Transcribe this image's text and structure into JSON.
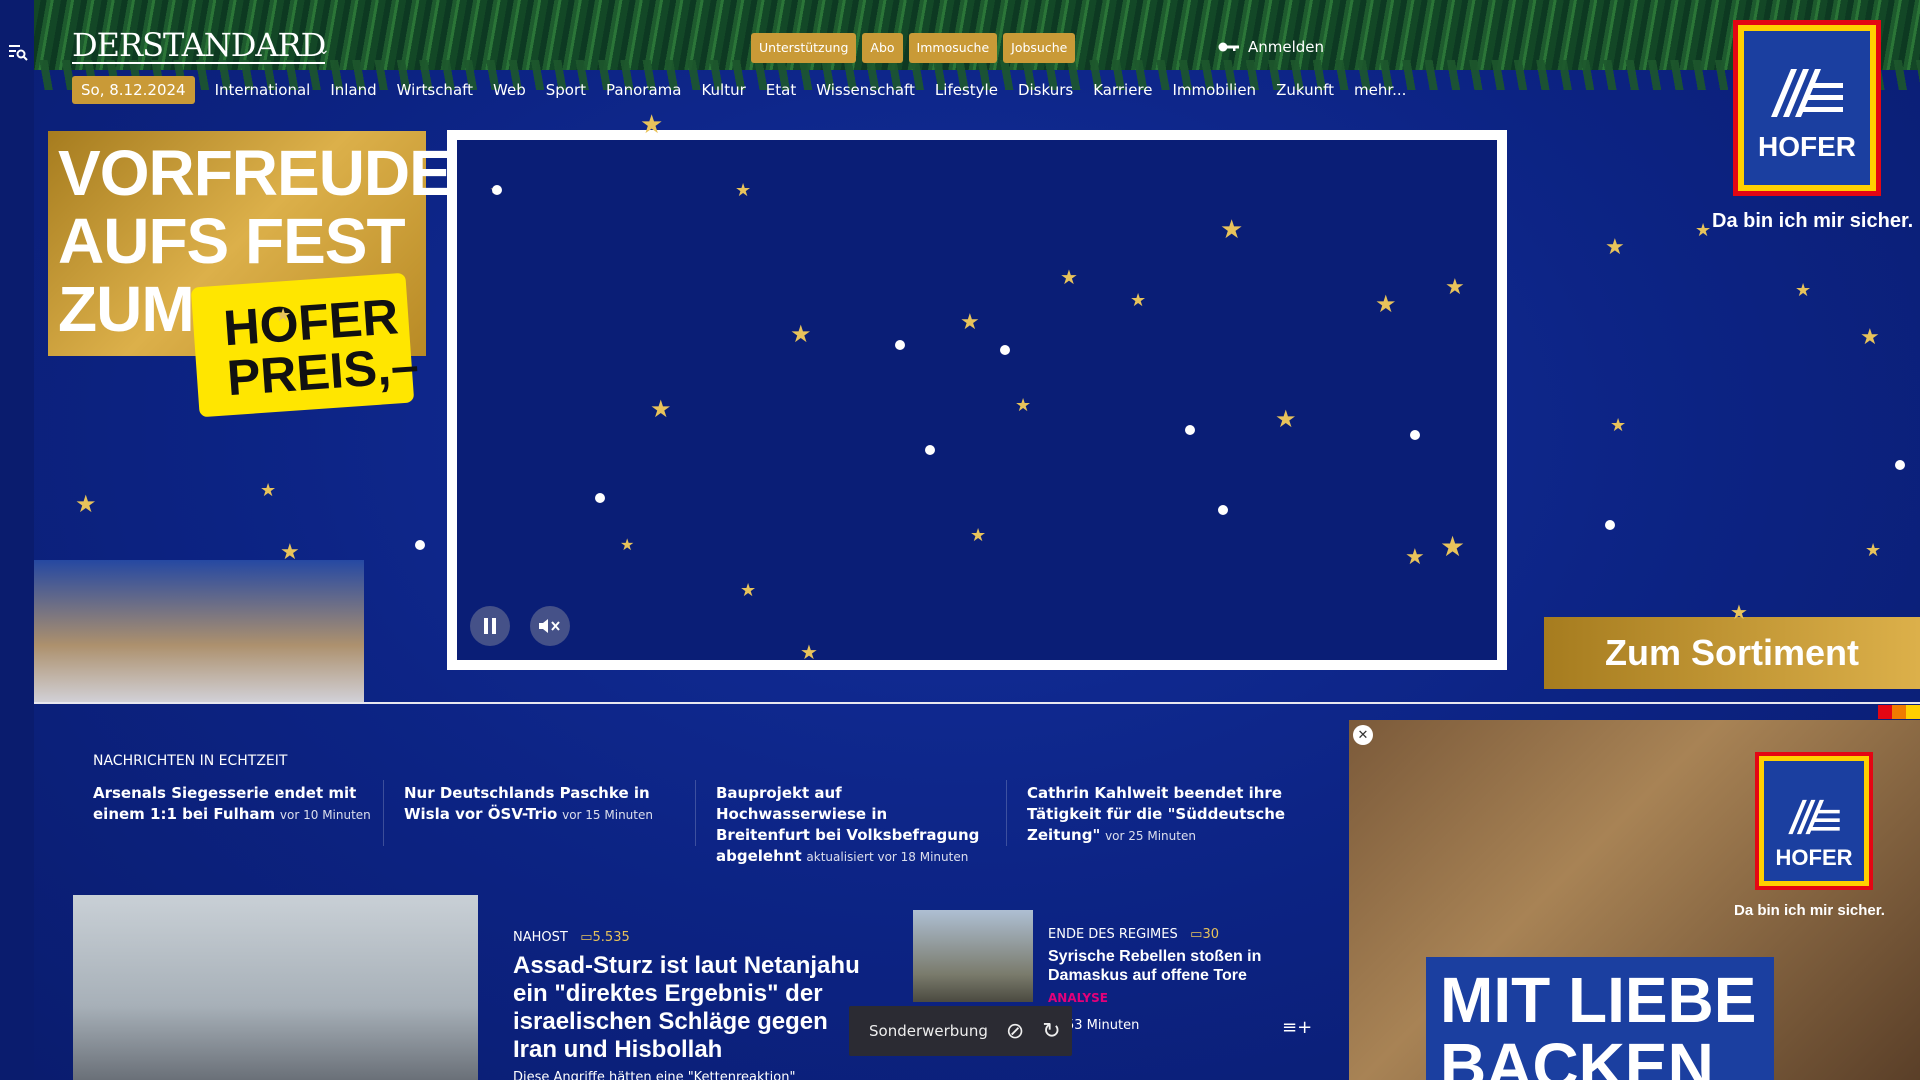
{
  "header": {
    "logo": "DERSTANDARD",
    "top_links": [
      "Unterstützung",
      "Abo",
      "Immosuche",
      "Jobsuche"
    ],
    "login": "Anmelden",
    "date": "So, 8.12.2024",
    "nav": [
      "International",
      "Inland",
      "Wirtschaft",
      "Web",
      "Sport",
      "Panorama",
      "Kultur",
      "Etat",
      "Wissenschaft",
      "Lifestyle",
      "Diskurs",
      "Karriere",
      "Immobilien",
      "Zukunft",
      "mehr..."
    ]
  },
  "ad_left": {
    "line1": "VORFREUDE",
    "line2": "AUFS FEST",
    "line3": "ZUM",
    "badge_line1": "HOFER",
    "badge_line2": "PREIS,–"
  },
  "ad_right": {
    "brand": "HOFER",
    "tagline": "Da bin ich mir sicher.",
    "cta": "Zum Sortiment"
  },
  "realtime": {
    "title": "NACHRICHTEN IN ECHTZEIT",
    "items": [
      {
        "headline": "Arsenals Siegesserie endet mit einem 1:1 bei Fulham",
        "time": "vor 10 Minuten"
      },
      {
        "headline": "Nur Deutschlands Paschke in Wisla vor ÖSV-Trio",
        "time": "vor 15 Minuten"
      },
      {
        "headline": "Bauprojekt auf Hochwasserwiese in Breitenfurt bei Volksbefragung abgelehnt",
        "time": "aktualisiert vor 18 Minuten"
      },
      {
        "headline": "Cathrin Kahlweit beendet ihre Tätigkeit für die \"Süddeutsche Zeitung\"",
        "time": "vor 25 Minuten"
      }
    ]
  },
  "lead_story": {
    "kicker": "NAHOST",
    "comments": "5.535",
    "headline": "Assad-Sturz ist laut Netanjahu ein \"direktes Ergebnis\" der israelischen Schläge gegen Iran und Hisbollah",
    "teaser": "Diese Angriffe hätten eine \"Kettenreaktion\""
  },
  "second_story": {
    "kicker": "ENDE DES REGIMES",
    "comments": "30",
    "headline": "Syrische Rebellen stoßen in Damaskus auf offene Tore",
    "label": "ANALYSE",
    "time": "53 Minuten"
  },
  "sonderwerbung": {
    "label": "Sonderwerbung"
  },
  "ad_bottom": {
    "brand": "HOFER",
    "tagline": "Da bin ich mir sicher.",
    "headline1": "MIT LIEBE",
    "headline2": "BACKEN"
  },
  "colors": {
    "background": "#0c2383",
    "gold": "#c99a37",
    "hofer_red": "#e40613",
    "hofer_blue": "#1b3fa0",
    "hofer_yellow": "#ffd000",
    "analyse": "#e3007a"
  }
}
